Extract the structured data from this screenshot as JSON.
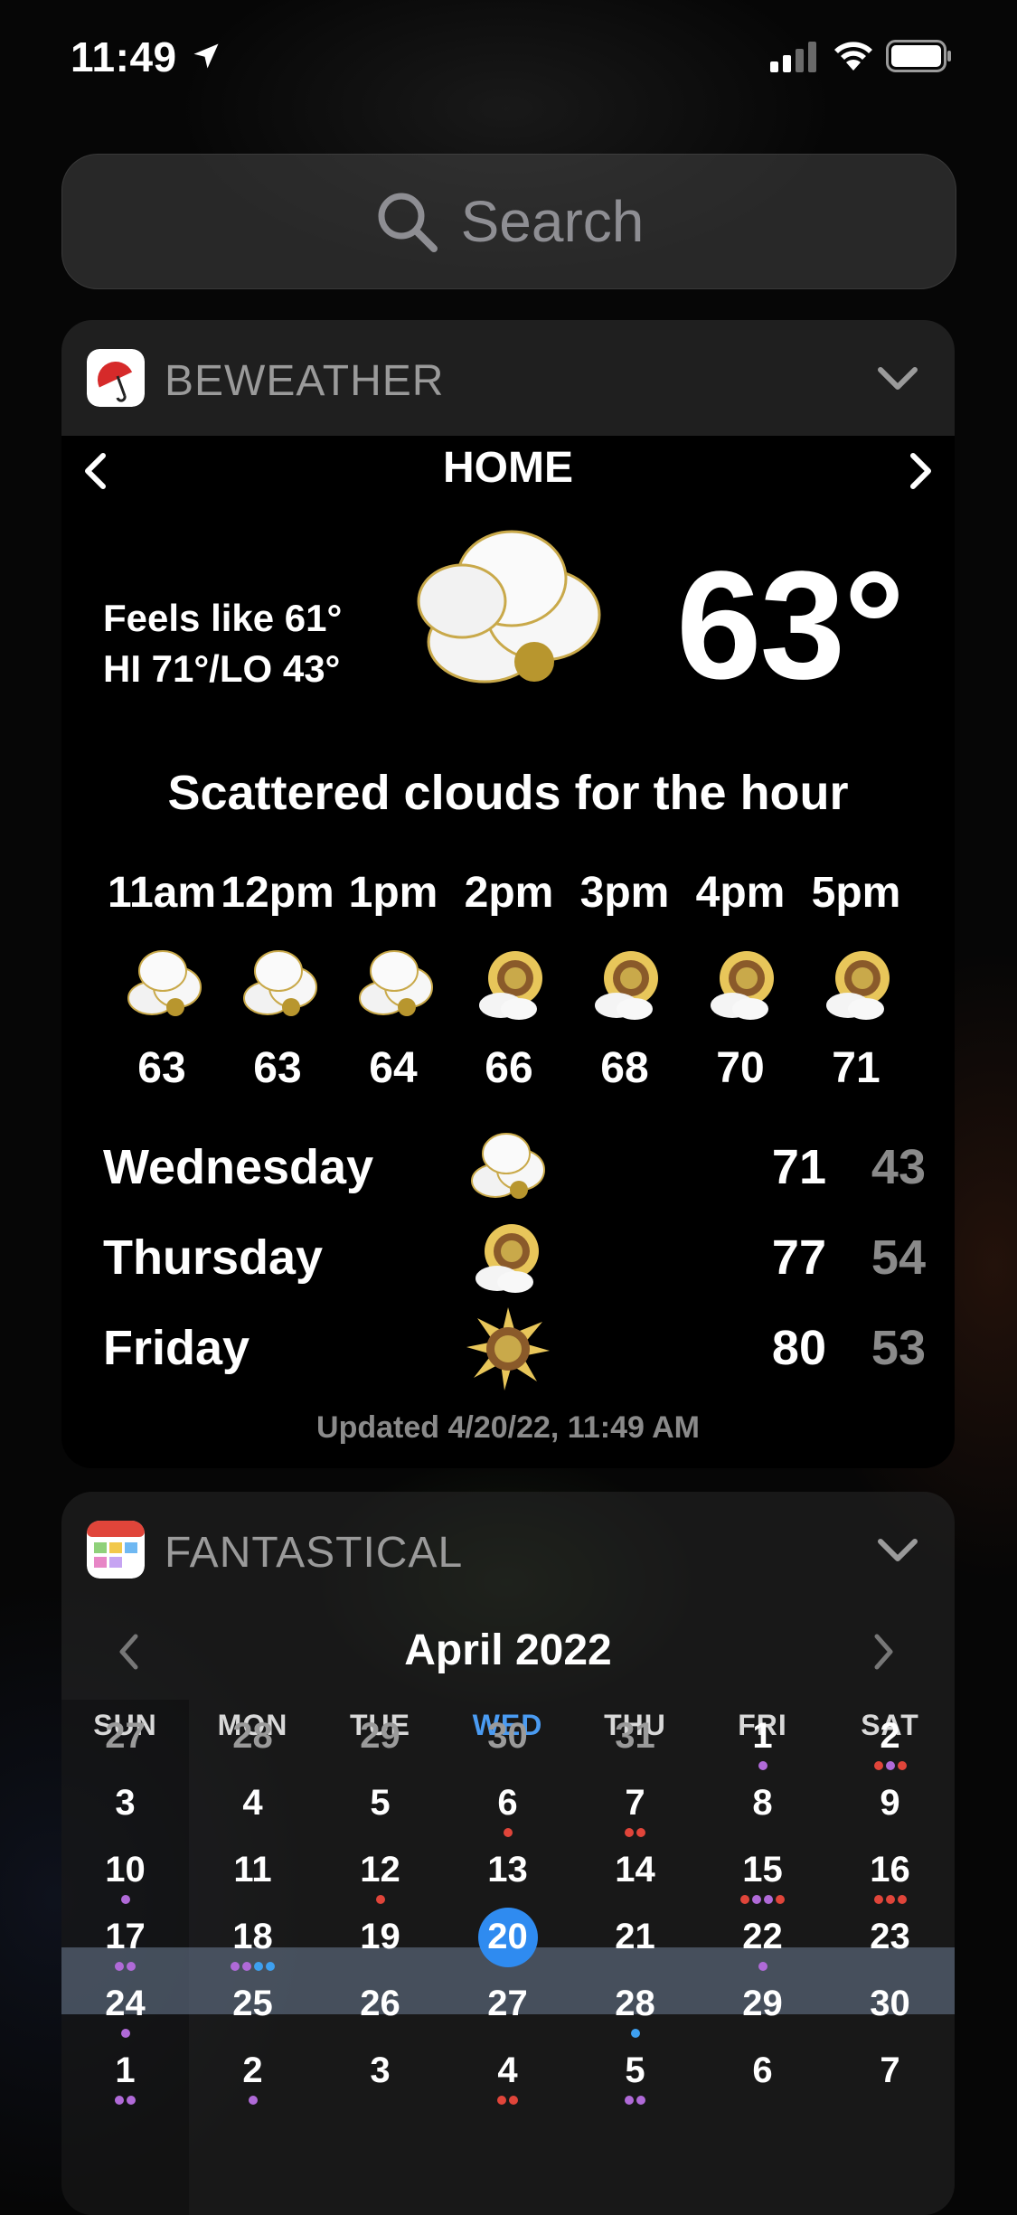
{
  "status_bar": {
    "time": "11:49"
  },
  "search": {
    "placeholder": "Search"
  },
  "weather_widget": {
    "app_name": "BEWEATHER",
    "location": "HOME",
    "feels_like": "Feels like 61°",
    "hi_lo": "HI 71°/LO 43°",
    "current_temp": "63°",
    "summary": "Scattered clouds for the hour",
    "hourly": [
      {
        "label": "11am",
        "temp": "63",
        "icon": "cloudy-icon"
      },
      {
        "label": "12pm",
        "temp": "63",
        "icon": "cloudy-icon"
      },
      {
        "label": "1pm",
        "temp": "64",
        "icon": "cloudy-icon"
      },
      {
        "label": "2pm",
        "temp": "66",
        "icon": "partly-sunny-icon"
      },
      {
        "label": "3pm",
        "temp": "68",
        "icon": "partly-sunny-icon"
      },
      {
        "label": "4pm",
        "temp": "70",
        "icon": "partly-sunny-icon"
      },
      {
        "label": "5pm",
        "temp": "71",
        "icon": "partly-sunny-icon"
      }
    ],
    "daily": [
      {
        "day": "Wednesday",
        "hi": "71",
        "lo": "43",
        "icon": "cloudy-icon"
      },
      {
        "day": "Thursday",
        "hi": "77",
        "lo": "54",
        "icon": "partly-sunny-icon"
      },
      {
        "day": "Friday",
        "hi": "80",
        "lo": "53",
        "icon": "sunny-icon"
      }
    ],
    "updated": "Updated 4/20/22, 11:49 AM"
  },
  "calendar_widget": {
    "app_name": "FANTASTICAL",
    "month_title": "April 2022",
    "weekdays": [
      "SUN",
      "MON",
      "TUE",
      "WED",
      "THU",
      "FRI",
      "SAT"
    ],
    "colors": {
      "today": "#2f8bf0",
      "purple": "#b06ad8",
      "red": "#e0453a",
      "blue": "#3ea0f0",
      "weekday_highlight": "#4a9bf2"
    },
    "weeks": [
      [
        "27",
        "28",
        "29",
        "30",
        "31",
        "1",
        "2"
      ],
      [
        "3",
        "4",
        "5",
        "6",
        "7",
        "8",
        "9"
      ],
      [
        "10",
        "11",
        "12",
        "13",
        "14",
        "15",
        "16"
      ],
      [
        "17",
        "18",
        "19",
        "20",
        "21",
        "22",
        "23"
      ],
      [
        "24",
        "25",
        "26",
        "27",
        "28",
        "29",
        "30"
      ],
      [
        "1",
        "2",
        "3",
        "4",
        "5",
        "6",
        "7"
      ]
    ],
    "today": "20"
  }
}
